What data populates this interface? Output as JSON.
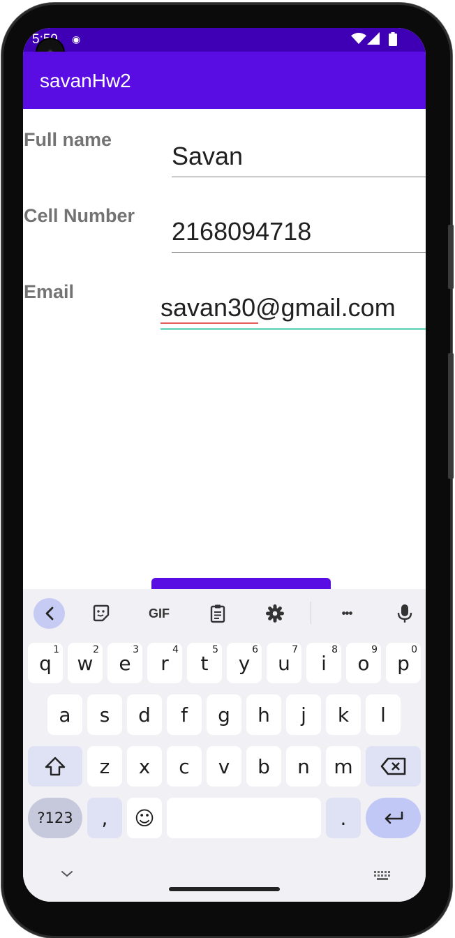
{
  "status": {
    "time": "5:59"
  },
  "app": {
    "title": "savanHw2"
  },
  "form": {
    "fields": [
      {
        "label": "Full name",
        "value": "Savan"
      },
      {
        "label": "Cell Number",
        "value": "2168094718"
      },
      {
        "label": "Email",
        "value": "savan30@gmail.com"
      }
    ]
  },
  "keyboard": {
    "toolbar": {
      "gif_label": "GIF",
      "more_label": "•••"
    },
    "row1": [
      {
        "k": "q",
        "h": "1"
      },
      {
        "k": "w",
        "h": "2"
      },
      {
        "k": "e",
        "h": "3"
      },
      {
        "k": "r",
        "h": "4"
      },
      {
        "k": "t",
        "h": "5"
      },
      {
        "k": "y",
        "h": "6"
      },
      {
        "k": "u",
        "h": "7"
      },
      {
        "k": "i",
        "h": "8"
      },
      {
        "k": "o",
        "h": "9"
      },
      {
        "k": "p",
        "h": "0"
      }
    ],
    "row2": [
      "a",
      "s",
      "d",
      "f",
      "g",
      "h",
      "j",
      "k",
      "l"
    ],
    "row3": [
      "z",
      "x",
      "c",
      "v",
      "b",
      "n",
      "m"
    ],
    "symbols_label": "?123",
    "comma": ",",
    "period": ".",
    "emoji": "☺"
  },
  "colors": {
    "status_bar": "#3f00b5",
    "app_bar": "#5a0de3",
    "label_gray": "#737373",
    "focus_underline": "#7ad9c4",
    "keyboard_bg": "#f1f0f5"
  }
}
